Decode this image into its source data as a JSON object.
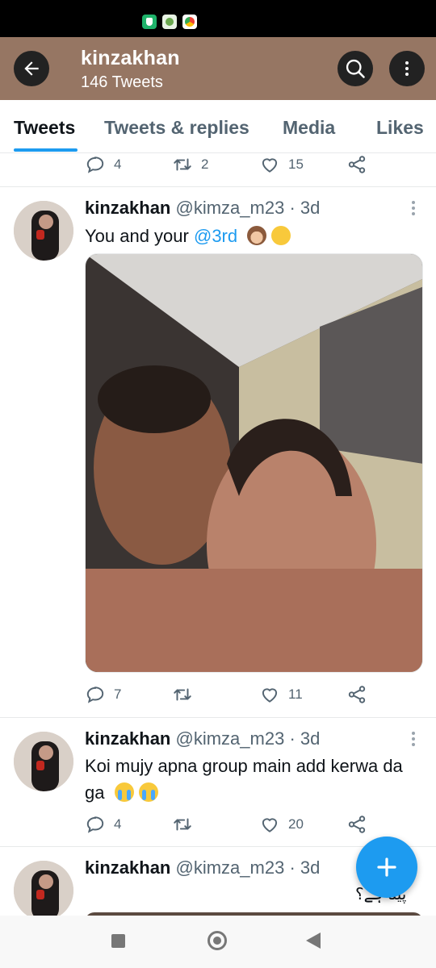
{
  "header": {
    "title": "kinzakhan",
    "subtitle": "146 Tweets",
    "back_icon": "arrow-left-icon",
    "search_icon": "search-icon",
    "more_icon": "more-vertical-icon",
    "background": "#967663"
  },
  "tabs": [
    {
      "label": "Tweets",
      "active": true
    },
    {
      "label": "Tweets & replies",
      "active": false
    },
    {
      "label": "Media",
      "active": false
    },
    {
      "label": "Likes",
      "active": false
    }
  ],
  "top_actions": {
    "replies": "4",
    "retweets": "2",
    "likes": "15"
  },
  "tweets": [
    {
      "name": "kinzakhan",
      "handle": "@kimza_m23",
      "time": "3d",
      "text_before": "You and your",
      "mention": "@3rd",
      "emojis": [
        "see-no-evil-monkey-emoji",
        "hand-over-mouth-emoji"
      ],
      "has_media": true,
      "replies": "7",
      "retweets": "",
      "likes": "11"
    },
    {
      "name": "kinzakhan",
      "handle": "@kimza_m23",
      "time": "3d",
      "text": "Koi mujy apna group main add kerwa da ga",
      "emojis": [
        "loudly-crying-emoji",
        "loudly-crying-emoji"
      ],
      "replies": "4",
      "retweets": "",
      "likes": "20"
    },
    {
      "name": "kinzakhan",
      "handle": "@kimza_m23",
      "time": "3d",
      "text": "پینا ہے؟"
    }
  ],
  "colors": {
    "accent": "#1d9bf0",
    "muted": "#536471",
    "text": "#0f1419"
  }
}
